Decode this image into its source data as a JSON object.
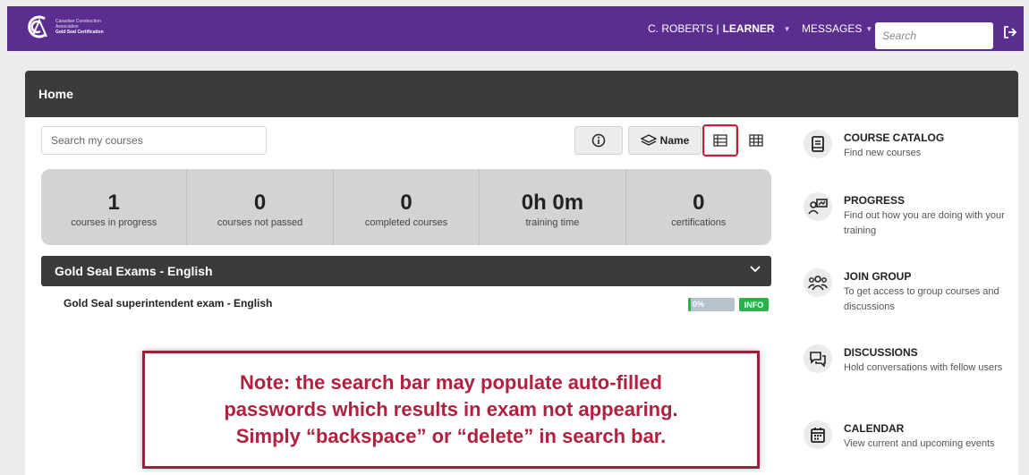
{
  "header": {
    "logo": {
      "line1": "Canadian Construction",
      "line2": "Association",
      "line3": "Gold Seal Certification"
    },
    "user_name": "C. ROBERTS |",
    "user_role": "LEARNER",
    "messages_label": "MESSAGES",
    "search_placeholder": "Search",
    "brand_color": "#5b2d8e"
  },
  "page": {
    "title": "Home",
    "course_search_placeholder": "Search my courses",
    "sort_label": "Name"
  },
  "stats": [
    {
      "value": "1",
      "label": "courses in progress"
    },
    {
      "value": "0",
      "label": "courses not passed"
    },
    {
      "value": "0",
      "label": "completed courses"
    },
    {
      "value": "0h 0m",
      "label": "training time"
    },
    {
      "value": "0",
      "label": "certifications"
    }
  ],
  "group": {
    "title": "Gold Seal Exams - English",
    "courses": [
      {
        "name": "Gold Seal superintendent exam - English",
        "progress_text": "0%",
        "progress_fraction": 0.05,
        "badge": "INFO"
      }
    ]
  },
  "sidebar": [
    {
      "title": "COURSE CATALOG",
      "desc": "Find new courses",
      "icon": "book-icon"
    },
    {
      "title": "PROGRESS",
      "desc": "Find out how you are doing with your training",
      "icon": "progress-chart-icon"
    },
    {
      "title": "JOIN GROUP",
      "desc": "To get access to group courses and discussions",
      "icon": "group-icon"
    },
    {
      "title": "DISCUSSIONS",
      "desc": "Hold conversations with fellow users",
      "icon": "chat-icon"
    },
    {
      "title": "CALENDAR",
      "desc": "View current and upcoming events",
      "icon": "calendar-icon"
    }
  ],
  "note": {
    "line1": "Note: the search bar may populate auto-filled",
    "line2": "passwords which results in exam not appearing.",
    "line3": "Simply “backspace” or “delete” in search bar.",
    "color": "#b0213f"
  }
}
